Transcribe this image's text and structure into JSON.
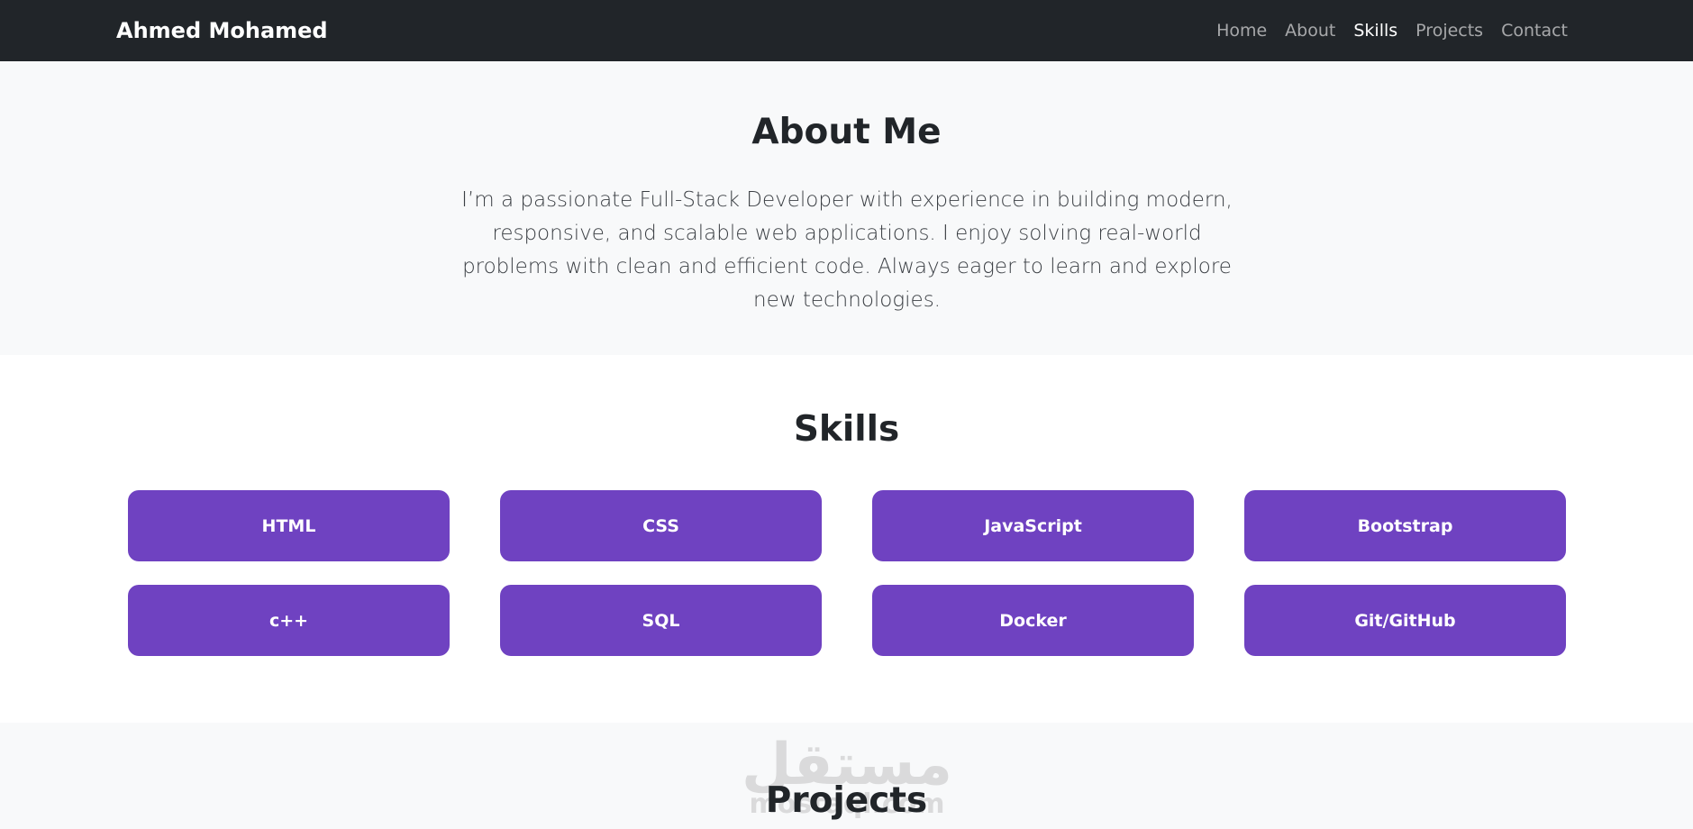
{
  "navbar": {
    "brand": "Ahmed Mohamed",
    "links": [
      {
        "label": "Home",
        "active": false
      },
      {
        "label": "About",
        "active": false
      },
      {
        "label": "Skills",
        "active": true
      },
      {
        "label": "Projects",
        "active": false
      },
      {
        "label": "Contact",
        "active": false
      }
    ]
  },
  "about": {
    "title": "About Me",
    "text": "I’m a passionate Full-Stack Developer with experience in building modern, responsive, and scalable web applications. I enjoy solving real-world problems with clean and efficient code. Always eager to learn and explore new technologies."
  },
  "skills": {
    "title": "Skills",
    "items": [
      {
        "label": "HTML"
      },
      {
        "label": "CSS"
      },
      {
        "label": "JavaScript"
      },
      {
        "label": "Bootstrap"
      },
      {
        "label": "c++"
      },
      {
        "label": "SQL"
      },
      {
        "label": "Docker"
      },
      {
        "label": "Git/GitHub"
      }
    ]
  },
  "projects": {
    "title": "Projects"
  },
  "watermark": {
    "arabic": "مستقل",
    "latin": "mostaql.com"
  },
  "colors": {
    "navbar": "#212529",
    "accent": "#6f42c1",
    "section_alt": "#f8f9fa"
  }
}
